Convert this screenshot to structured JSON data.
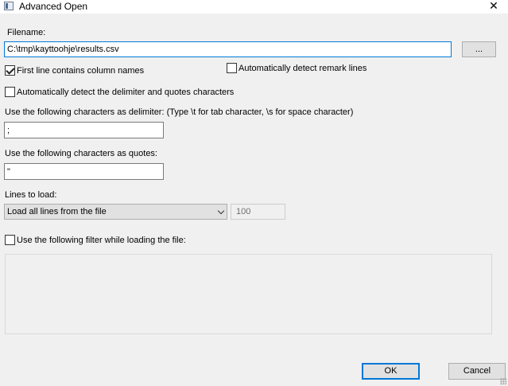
{
  "window": {
    "title": "Advanced Open",
    "close_glyph": "✕"
  },
  "filename": {
    "label": "Filename:",
    "value": "C:\\tmp\\kayttoohje\\results.csv",
    "browse_label": "..."
  },
  "options": {
    "first_line_names": {
      "label": "First line contains column names",
      "checked": true
    },
    "detect_remark": {
      "label": "Automatically detect remark lines",
      "checked": false
    },
    "detect_delimiter": {
      "label": "Automatically detect the delimiter and quotes characters",
      "checked": false
    }
  },
  "delimiter": {
    "label": "Use the following characters as delimiter: (Type  \\t for tab character, \\s for space character)",
    "value": ";"
  },
  "quotes": {
    "label": "Use the following characters as quotes:",
    "value": "\""
  },
  "lines": {
    "label": "Lines to load:",
    "selected": "Load all lines from the file",
    "count": "100"
  },
  "filter": {
    "label": "Use the following filter while loading the file:",
    "checked": false
  },
  "buttons": {
    "ok": "OK",
    "cancel": "Cancel"
  },
  "icons": {
    "window": "window-icon",
    "close": "close-icon",
    "dropdown": "chevron-down-icon",
    "grip": "resize-grip-icon"
  }
}
